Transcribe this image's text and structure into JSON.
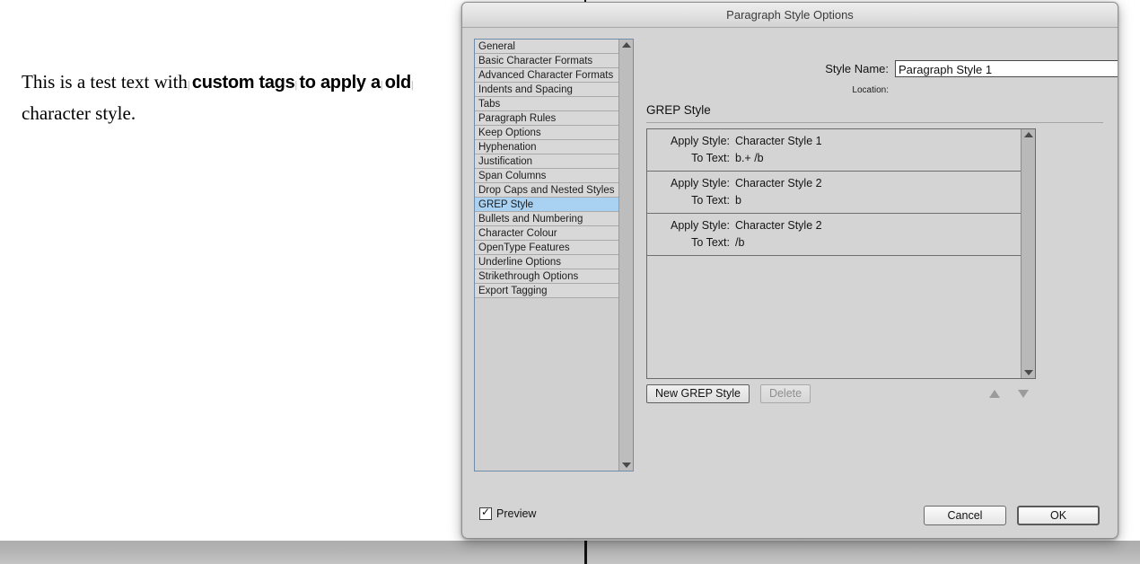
{
  "document": {
    "line1_part1": "This is a test text with",
    "line1_tag1": "custom tags",
    "line1_tag2": "to apply a",
    "line2_tag": "old",
    "line2_rest": "character style."
  },
  "dialog": {
    "title": "Paragraph Style Options",
    "sidebar": {
      "items": [
        {
          "label": "General",
          "selected": false
        },
        {
          "label": "Basic Character Formats",
          "selected": false
        },
        {
          "label": "Advanced Character Formats",
          "selected": false
        },
        {
          "label": "Indents and Spacing",
          "selected": false
        },
        {
          "label": "Tabs",
          "selected": false
        },
        {
          "label": "Paragraph Rules",
          "selected": false
        },
        {
          "label": "Keep Options",
          "selected": false
        },
        {
          "label": "Hyphenation",
          "selected": false
        },
        {
          "label": "Justification",
          "selected": false
        },
        {
          "label": "Span Columns",
          "selected": false
        },
        {
          "label": "Drop Caps and Nested Styles",
          "selected": false
        },
        {
          "label": "GREP Style",
          "selected": true
        },
        {
          "label": "Bullets and Numbering",
          "selected": false
        },
        {
          "label": "Character Colour",
          "selected": false
        },
        {
          "label": "OpenType Features",
          "selected": false
        },
        {
          "label": "Underline Options",
          "selected": false
        },
        {
          "label": "Strikethrough Options",
          "selected": false
        },
        {
          "label": "Export Tagging",
          "selected": false
        }
      ],
      "selected_color": "#a9d2f2"
    },
    "style_name": {
      "label": "Style Name:",
      "value": "Paragraph Style 1"
    },
    "location": {
      "label": "Location:",
      "value": ""
    },
    "section": {
      "title": "GREP Style"
    },
    "grep_entries": [
      {
        "apply_label": "Apply Style:",
        "apply_value": "Character Style 1",
        "totext_label": "To Text:",
        "totext_value": "b.+ /b"
      },
      {
        "apply_label": "Apply Style:",
        "apply_value": "Character Style 2",
        "totext_label": "To Text:",
        "totext_value": "b"
      },
      {
        "apply_label": "Apply Style:",
        "apply_value": "Character Style 2",
        "totext_label": "To Text:",
        "totext_value": "/b"
      }
    ],
    "list_buttons": {
      "new_grep_style": "New GREP Style",
      "delete": "Delete",
      "move_up_icon": "triangle-up-icon",
      "move_down_icon": "triangle-down-icon"
    },
    "footer": {
      "preview_label": "Preview",
      "preview_checked": true,
      "cancel": "Cancel",
      "ok": "OK"
    }
  }
}
